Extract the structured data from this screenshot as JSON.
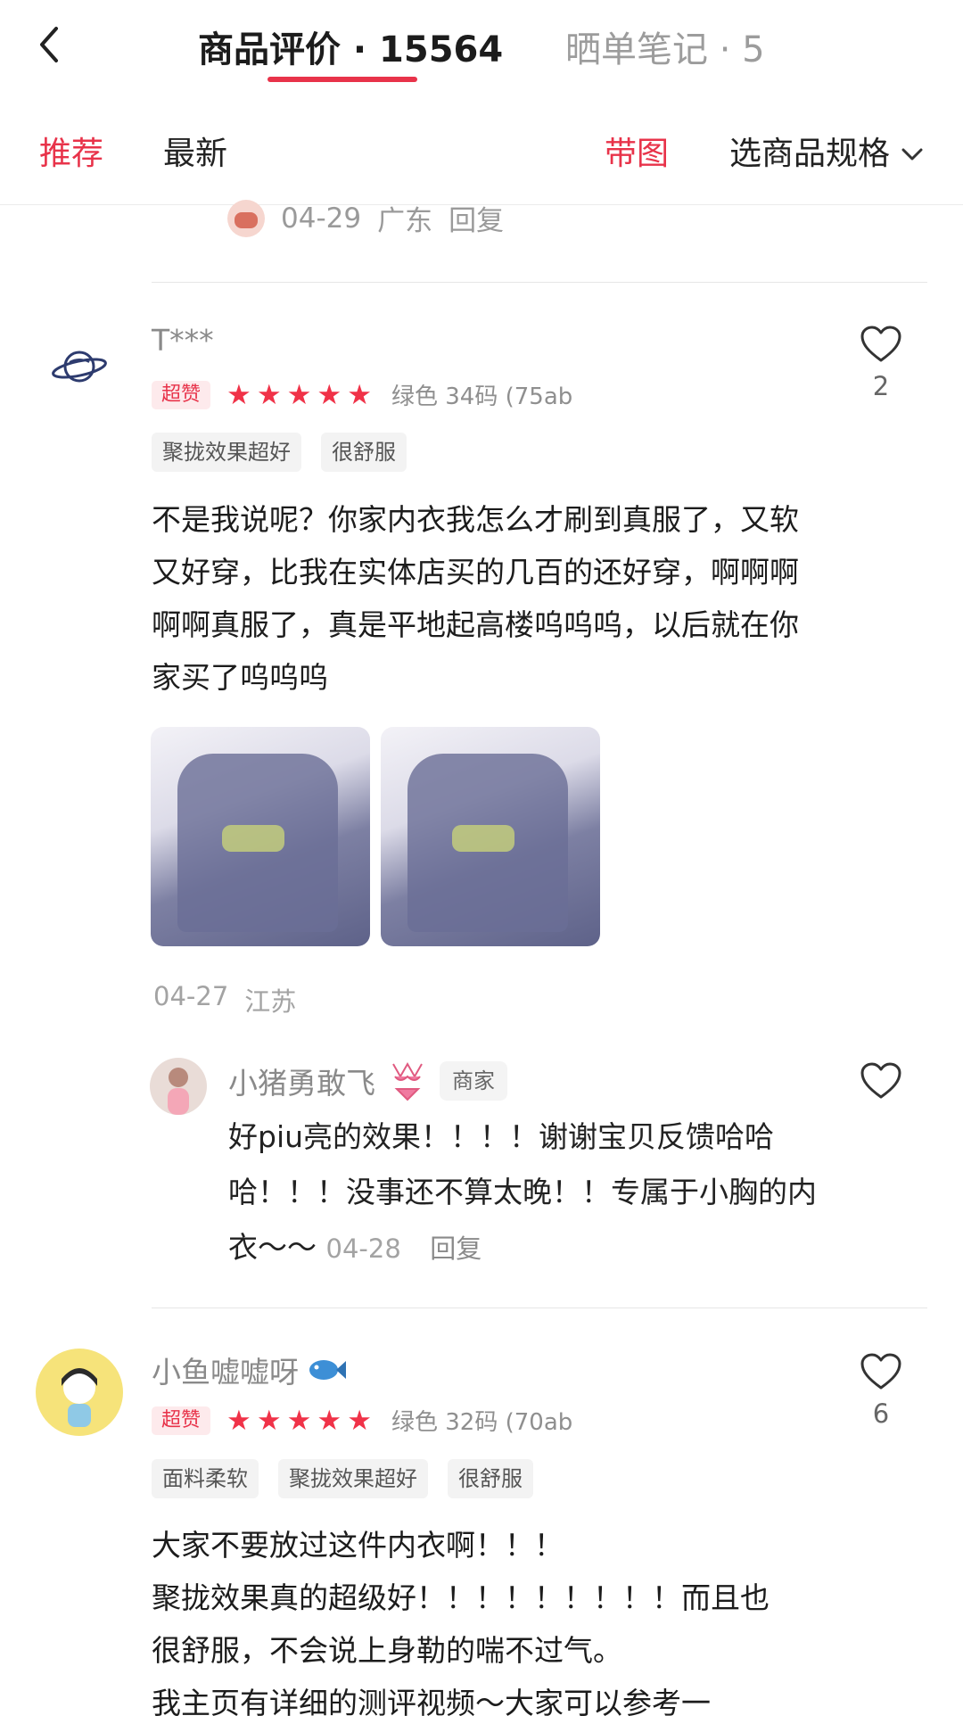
{
  "header": {
    "tab_reviews": "商品评价 · 15564",
    "tab_notes": "晒单笔记 · 5"
  },
  "filters": {
    "recommend": "推荐",
    "latest": "最新",
    "with_pictures": "带图",
    "select_spec": "选商品规格"
  },
  "previous_reply": {
    "date": "04-29",
    "location": "广东",
    "reply": "回复"
  },
  "reviews": [
    {
      "username": "T***",
      "badge": "超赞",
      "stars": 5,
      "spec": "绿色 34码 (75ab",
      "tags": [
        "聚拢效果超好",
        "很舒服"
      ],
      "text": "不是我说呢？你家内衣我怎么才刷到真服了，又软又好穿，比我在实体店买的几百的还好穿，啊啊啊啊啊真服了，真是平地起高楼呜呜呜，以后就在你家买了呜呜呜",
      "date": "04-27",
      "location": "江苏",
      "likes": "2",
      "seller_reply": {
        "name": "小猪勇敢飞",
        "badge": "商家",
        "text": "好piu亮的效果！！！！谢谢宝贝反馈哈哈哈！！！没事还不算太晚！！专属于小胸的内衣～～",
        "date": "04-28",
        "reply": "回复"
      }
    },
    {
      "username": "小鱼嘘嘘呀",
      "badge": "超赞",
      "stars": 5,
      "spec": "绿色 32码 (70ab",
      "tags": [
        "面料柔软",
        "聚拢效果超好",
        "很舒服"
      ],
      "text": "大家不要放过这件内衣啊！！！\n聚拢效果真的超级好！！！！！！！！！而且也很舒服，不会说上身勒的喘不过气。\n我主页有详细的测评视频～大家可以参考一",
      "likes": "6"
    }
  ],
  "colors": {
    "accent": "#e8334a",
    "star": "#f03248"
  }
}
